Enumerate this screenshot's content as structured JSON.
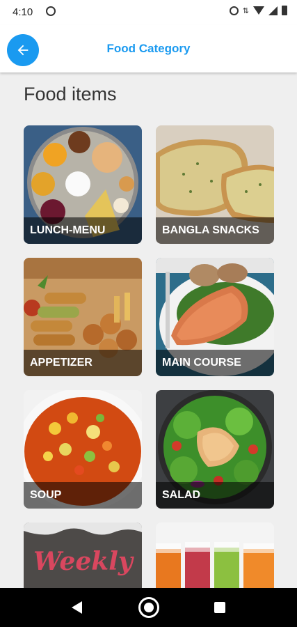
{
  "status_bar": {
    "time": "4:10"
  },
  "app_bar": {
    "title": "Food Category"
  },
  "section": {
    "title": "Food items"
  },
  "categories": [
    {
      "label": "LUNCH-MENU"
    },
    {
      "label": "BANGLA SNACKS"
    },
    {
      "label": "APPETIZER"
    },
    {
      "label": "MAIN COURSE"
    },
    {
      "label": "SOUP"
    },
    {
      "label": "SALAD"
    },
    {
      "label": "",
      "image_text": "Weekly Special"
    },
    {
      "label": ""
    }
  ],
  "colors": {
    "accent": "#1a9af0",
    "background": "#efefef"
  },
  "icons": {
    "back": "arrow-left-icon",
    "nav_back": "nav-back-icon",
    "nav_home": "nav-home-icon",
    "nav_recents": "nav-recents-icon"
  }
}
